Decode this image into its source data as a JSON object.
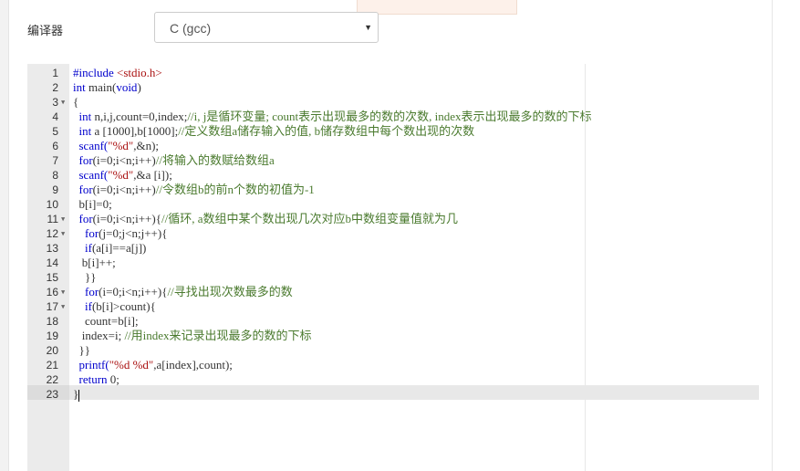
{
  "compiler": {
    "label": "编译器",
    "selected": "C (gcc)"
  },
  "editor": {
    "lines": [
      {
        "n": "1",
        "fold": false,
        "segs": [
          {
            "t": "#include ",
            "c": "kw"
          },
          {
            "t": "<stdio.h>",
            "c": "str"
          }
        ]
      },
      {
        "n": "2",
        "fold": false,
        "segs": [
          {
            "t": "int",
            "c": "kw"
          },
          {
            "t": " main("
          },
          {
            "t": "void",
            "c": "kw"
          },
          {
            "t": ")"
          }
        ]
      },
      {
        "n": "3",
        "fold": true,
        "segs": [
          {
            "t": "{"
          }
        ]
      },
      {
        "n": "4",
        "fold": false,
        "segs": [
          {
            "t": "  "
          },
          {
            "t": "int",
            "c": "kw"
          },
          {
            "t": " n,i,j,count=0,index;"
          },
          {
            "t": "//i, j是循环变量; count表示出现最多的数的次数, index表示出现最多的数的下标",
            "c": "cm"
          }
        ]
      },
      {
        "n": "5",
        "fold": false,
        "segs": [
          {
            "t": "  "
          },
          {
            "t": "int",
            "c": "kw"
          },
          {
            "t": " a [1000],b[1000];"
          },
          {
            "t": "//定义数组a储存输入的值, b储存数组中每个数出现的次数",
            "c": "cm"
          }
        ]
      },
      {
        "n": "6",
        "fold": false,
        "segs": [
          {
            "t": "  scanf(",
            "c": "kw"
          },
          {
            "t": "\"%d\"",
            "c": "str"
          },
          {
            "t": ",&n);"
          }
        ]
      },
      {
        "n": "7",
        "fold": false,
        "segs": [
          {
            "t": "  "
          },
          {
            "t": "for",
            "c": "kw"
          },
          {
            "t": "(i=0;i<n;i++)"
          },
          {
            "t": "//将输入的数赋给数组a",
            "c": "cm"
          }
        ]
      },
      {
        "n": "8",
        "fold": false,
        "segs": [
          {
            "t": "  scanf(",
            "c": "kw"
          },
          {
            "t": "\"%d\"",
            "c": "str"
          },
          {
            "t": ",&a [i]);"
          }
        ]
      },
      {
        "n": "9",
        "fold": false,
        "segs": [
          {
            "t": "  "
          },
          {
            "t": "for",
            "c": "kw"
          },
          {
            "t": "(i=0;i<n;i++)"
          },
          {
            "t": "//令数组b的前n个数的初值为-1",
            "c": "cm"
          }
        ]
      },
      {
        "n": "10",
        "fold": false,
        "segs": [
          {
            "t": "  b[i]=0;"
          }
        ]
      },
      {
        "n": "11",
        "fold": true,
        "segs": [
          {
            "t": "  "
          },
          {
            "t": "for",
            "c": "kw"
          },
          {
            "t": "(i=0;i<n;i++){"
          },
          {
            "t": "//循环, a数组中某个数出现几次对应b中数组变量值就为几",
            "c": "cm"
          }
        ]
      },
      {
        "n": "12",
        "fold": true,
        "segs": [
          {
            "t": "    "
          },
          {
            "t": "for",
            "c": "kw"
          },
          {
            "t": "(j=0;j<n;j++){"
          }
        ]
      },
      {
        "n": "13",
        "fold": false,
        "segs": [
          {
            "t": "    "
          },
          {
            "t": "if",
            "c": "kw"
          },
          {
            "t": "(a[i]==a[j])"
          }
        ]
      },
      {
        "n": "14",
        "fold": false,
        "segs": [
          {
            "t": "   b[i]++;"
          }
        ]
      },
      {
        "n": "15",
        "fold": false,
        "segs": [
          {
            "t": "    }}"
          }
        ]
      },
      {
        "n": "16",
        "fold": true,
        "segs": [
          {
            "t": "    "
          },
          {
            "t": "for",
            "c": "kw"
          },
          {
            "t": "(i=0;i<n;i++){"
          },
          {
            "t": "//寻找出现次数最多的数",
            "c": "cm"
          }
        ]
      },
      {
        "n": "17",
        "fold": true,
        "segs": [
          {
            "t": "    "
          },
          {
            "t": "if",
            "c": "kw"
          },
          {
            "t": "(b[i]>count){"
          }
        ]
      },
      {
        "n": "18",
        "fold": false,
        "segs": [
          {
            "t": "    count=b[i];"
          }
        ]
      },
      {
        "n": "19",
        "fold": false,
        "segs": [
          {
            "t": "   index=i; "
          },
          {
            "t": "//用index来记录出现最多的数的下标",
            "c": "cm"
          }
        ]
      },
      {
        "n": "20",
        "fold": false,
        "segs": [
          {
            "t": "  }}"
          }
        ]
      },
      {
        "n": "21",
        "fold": false,
        "segs": [
          {
            "t": "  printf(",
            "c": "kw"
          },
          {
            "t": "\"%d %d\"",
            "c": "str"
          },
          {
            "t": ",a[index],count);"
          }
        ]
      },
      {
        "n": "22",
        "fold": false,
        "segs": [
          {
            "t": "  "
          },
          {
            "t": "return",
            "c": "kw"
          },
          {
            "t": " 0;"
          }
        ]
      },
      {
        "n": "23",
        "fold": false,
        "segs": [
          {
            "t": "}"
          }
        ],
        "cursor": true
      }
    ]
  }
}
